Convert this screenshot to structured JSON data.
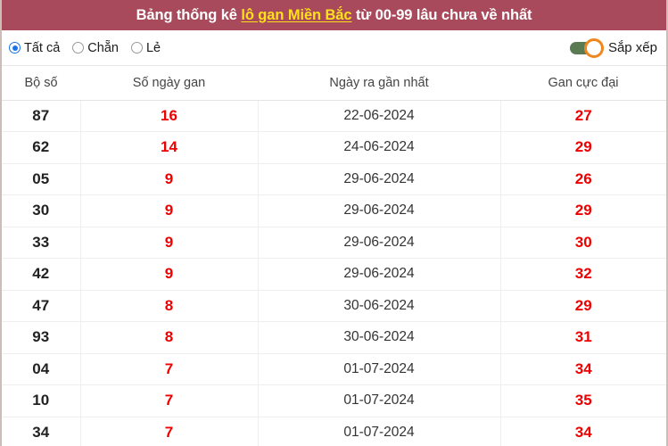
{
  "header": {
    "title_prefix": "Bảng thống kê ",
    "title_highlight": "lô gan Miền Bắc",
    "title_suffix": " từ 00-99 lâu chưa về nhất",
    "bg_color": "#a84a5c",
    "highlight_color": "#ffe01b"
  },
  "filters": {
    "radios": [
      {
        "label": "Tất cả",
        "checked": true
      },
      {
        "label": "Chẵn",
        "checked": false
      },
      {
        "label": "Lẻ",
        "checked": false
      }
    ],
    "accent_color": "#1a73e8",
    "sort": {
      "label": "Sắp xếp",
      "enabled": true,
      "track_color": "#5a7a52",
      "knob_color": "#f0871e"
    }
  },
  "table": {
    "columns": [
      "Bộ số",
      "Số ngày gan",
      "Ngày ra gần nhất",
      "Gan cực đại"
    ],
    "value_color": "#ee0000",
    "rows": [
      {
        "bo_so": "87",
        "so_ngay_gan": "16",
        "ngay_ra_gan_nhat": "22-06-2024",
        "gan_cuc_dai": "27"
      },
      {
        "bo_so": "62",
        "so_ngay_gan": "14",
        "ngay_ra_gan_nhat": "24-06-2024",
        "gan_cuc_dai": "29"
      },
      {
        "bo_so": "05",
        "so_ngay_gan": "9",
        "ngay_ra_gan_nhat": "29-06-2024",
        "gan_cuc_dai": "26"
      },
      {
        "bo_so": "30",
        "so_ngay_gan": "9",
        "ngay_ra_gan_nhat": "29-06-2024",
        "gan_cuc_dai": "29"
      },
      {
        "bo_so": "33",
        "so_ngay_gan": "9",
        "ngay_ra_gan_nhat": "29-06-2024",
        "gan_cuc_dai": "30"
      },
      {
        "bo_so": "42",
        "so_ngay_gan": "9",
        "ngay_ra_gan_nhat": "29-06-2024",
        "gan_cuc_dai": "32"
      },
      {
        "bo_so": "47",
        "so_ngay_gan": "8",
        "ngay_ra_gan_nhat": "30-06-2024",
        "gan_cuc_dai": "29"
      },
      {
        "bo_so": "93",
        "so_ngay_gan": "8",
        "ngay_ra_gan_nhat": "30-06-2024",
        "gan_cuc_dai": "31"
      },
      {
        "bo_so": "04",
        "so_ngay_gan": "7",
        "ngay_ra_gan_nhat": "01-07-2024",
        "gan_cuc_dai": "34"
      },
      {
        "bo_so": "10",
        "so_ngay_gan": "7",
        "ngay_ra_gan_nhat": "01-07-2024",
        "gan_cuc_dai": "35"
      },
      {
        "bo_so": "34",
        "so_ngay_gan": "7",
        "ngay_ra_gan_nhat": "01-07-2024",
        "gan_cuc_dai": "34"
      }
    ]
  }
}
